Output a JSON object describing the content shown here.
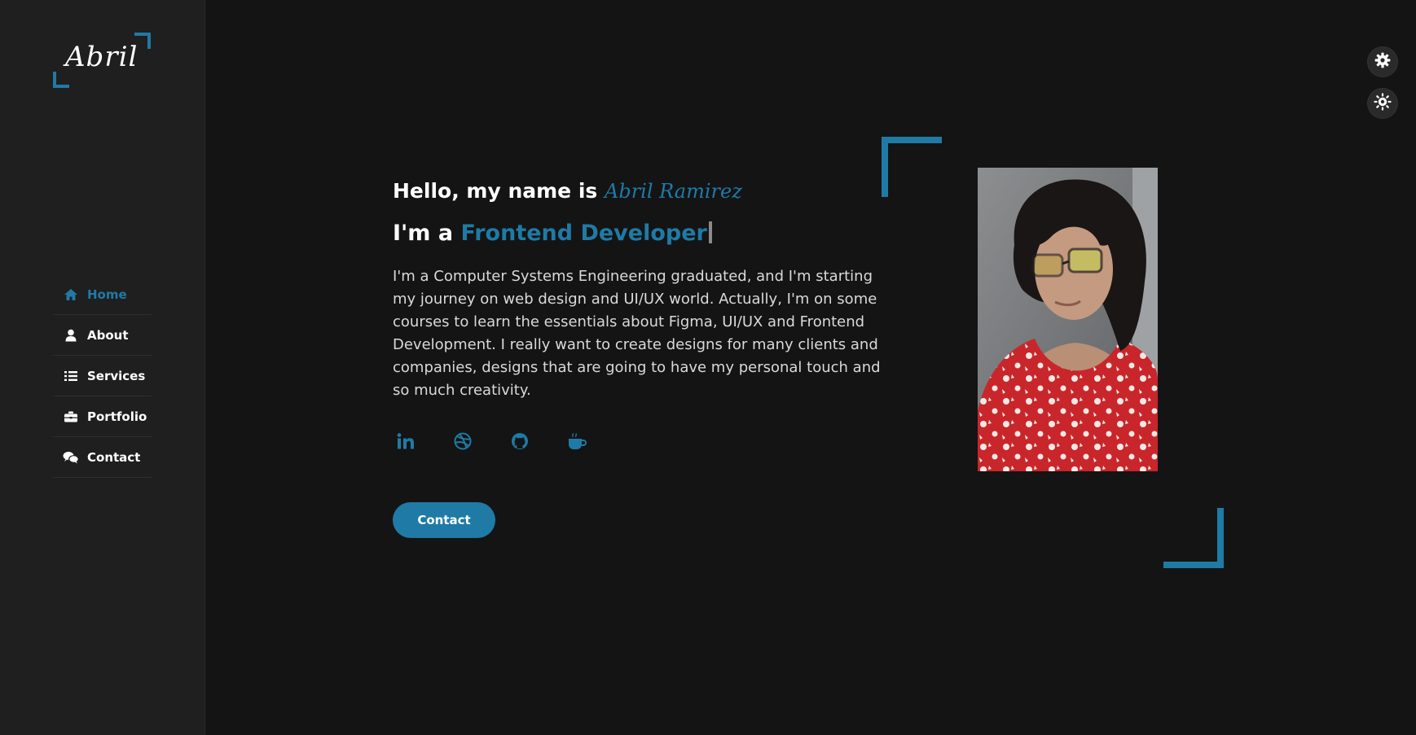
{
  "brand": {
    "logo_text": "Abril"
  },
  "nav": {
    "items": [
      {
        "label": "Home",
        "icon": "home-icon",
        "active": true
      },
      {
        "label": "About",
        "icon": "user-icon",
        "active": false
      },
      {
        "label": "Services",
        "icon": "list-icon",
        "active": false
      },
      {
        "label": "Portfolio",
        "icon": "briefcase-icon",
        "active": false
      },
      {
        "label": "Contact",
        "icon": "chat-icon",
        "active": false
      }
    ]
  },
  "hero": {
    "greeting": "Hello, my name is",
    "name": "Abril Ramirez",
    "role_prefix": "I'm a",
    "role": "Frontend Developer",
    "bio": "I'm a Computer Systems Engineering graduated, and I'm starting my journey on web design and UI/UX world. Actually, I'm on some courses to learn the essentials about Figma, UI/UX and Frontend Development. I really want to create designs for many clients and companies, designs that are going to have my personal touch and so much creativity.",
    "contact_label": "Contact"
  },
  "socials": [
    {
      "name": "linkedin-icon"
    },
    {
      "name": "dribbble-icon"
    },
    {
      "name": "github-icon"
    },
    {
      "name": "coffee-icon"
    }
  ],
  "colors": {
    "accent": "#1f7aa6",
    "background": "#141414",
    "sidebar": "#1f1f1f"
  }
}
